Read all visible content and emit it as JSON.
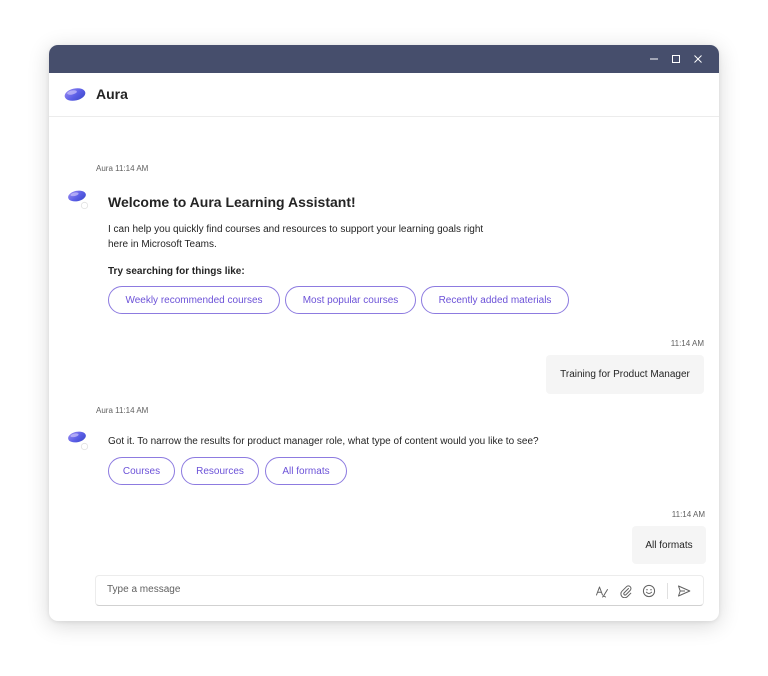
{
  "colors": {
    "titlebar": "#464e6c",
    "accent": "#6c52d8",
    "chip_border": "#8d7be0",
    "user_bubble": "#f5f5f5"
  },
  "window": {
    "controls": [
      "minimize-icon",
      "maximize-icon",
      "close-icon"
    ]
  },
  "header": {
    "app_name": "Aura",
    "logo_icon": "aura-logo-icon"
  },
  "messages": {
    "m1": {
      "author": "Aura",
      "time": "11:14 AM",
      "heading": "Welcome to Aura Learning Assistant!",
      "body_line1": "I can help you quickly find courses and resources to support your learning goals right",
      "body_line2": "here in Microsoft Teams.",
      "prompt": "Try searching for things like:",
      "chips": [
        "Weekly recommended courses",
        "Most popular courses",
        "Recently added materials"
      ]
    },
    "u1": {
      "time": "11:14 AM",
      "text": "Training for Product Manager"
    },
    "m2": {
      "author": "Aura",
      "time": "11:14 AM",
      "body": "Got it. To narrow the results for product manager role, what type of content would you like to see?",
      "chips": [
        "Courses",
        "Resources",
        "All formats"
      ]
    },
    "u2": {
      "time": "11:14 AM",
      "text": "All formats"
    }
  },
  "composer": {
    "placeholder": "Type a message",
    "tools": [
      "format-icon",
      "attach-icon",
      "emoji-icon",
      "send-icon"
    ]
  }
}
